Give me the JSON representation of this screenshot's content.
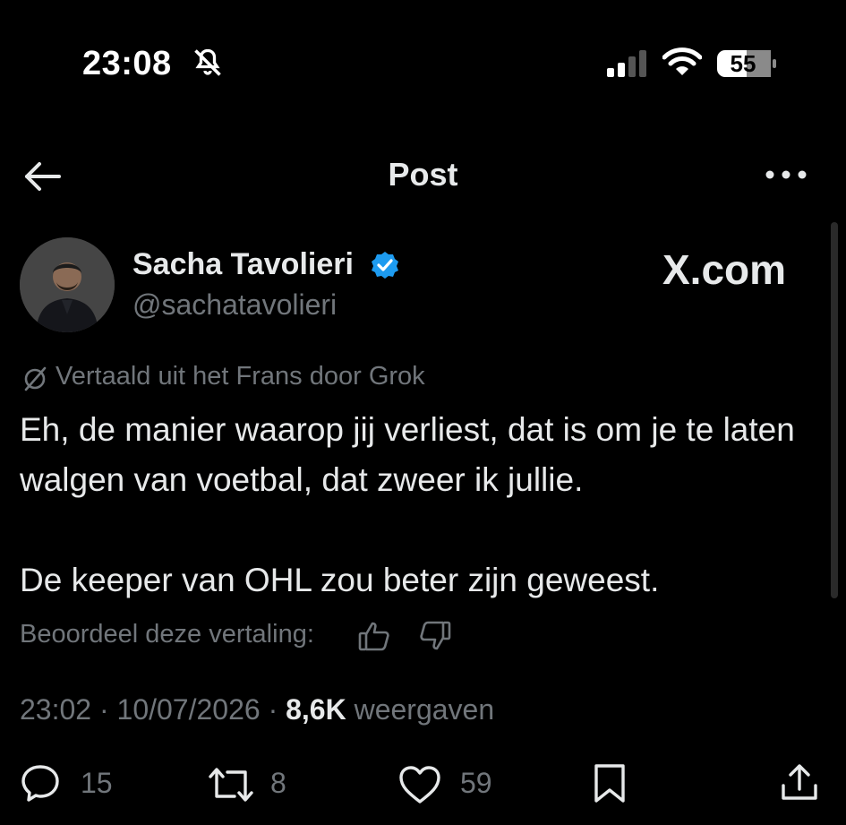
{
  "status_bar": {
    "time": "23:08",
    "battery": "55"
  },
  "header": {
    "title": "Post"
  },
  "author": {
    "name": "Sacha Tavolieri",
    "handle": "@sachatavolieri"
  },
  "watermark": "X.com",
  "translation": {
    "label": "Vertaald uit het Frans door Grok"
  },
  "post": {
    "paragraphs": [
      "Eh, de manier waarop jij verliest, dat is om je te laten walgen van voetbal, dat zweer ik jullie.",
      "De keeper van OHL zou beter zijn geweest."
    ]
  },
  "rating": {
    "label": "Beoordeel deze vertaling:"
  },
  "meta": {
    "time": "23:02",
    "date": "10/07/2026",
    "views": "8,6K",
    "views_label": "weergaven",
    "separator": "·"
  },
  "actions": {
    "replies": "15",
    "reposts": "8",
    "likes": "59"
  },
  "colors": {
    "background": "#000000",
    "text": "#e7e9ea",
    "secondary": "#71767b",
    "verified": "#1d9bf0"
  }
}
